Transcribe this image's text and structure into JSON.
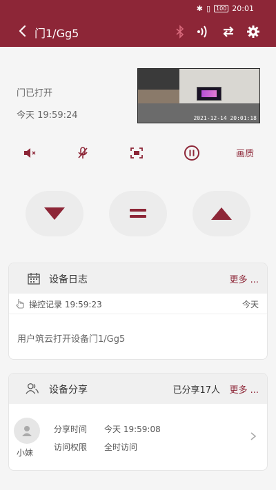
{
  "statusbar": {
    "battery": "100",
    "time": "20:01"
  },
  "header": {
    "title": "门1/Gg5"
  },
  "device": {
    "status": "门已打开",
    "time": "今天 19:59:24",
    "video_timestamp": "2021-12-14 20:01:18"
  },
  "controls": {
    "quality_label": "画质"
  },
  "log": {
    "title": "设备日志",
    "more": "更多 ...",
    "record_label": "操控记录 19:59:23",
    "record_day": "今天",
    "message": "用户筑云打开设备门1/Gg5"
  },
  "share": {
    "title": "设备分享",
    "count": "已分享17人",
    "more": "更多 ...",
    "user_name": "小妹",
    "time_label": "分享时间",
    "time_value": "今天 19:59:08",
    "access_label": "访问权限",
    "access_value": "全时访问"
  },
  "colors": {
    "brand": "#8d2637",
    "accent_light": "#d96a7c"
  }
}
